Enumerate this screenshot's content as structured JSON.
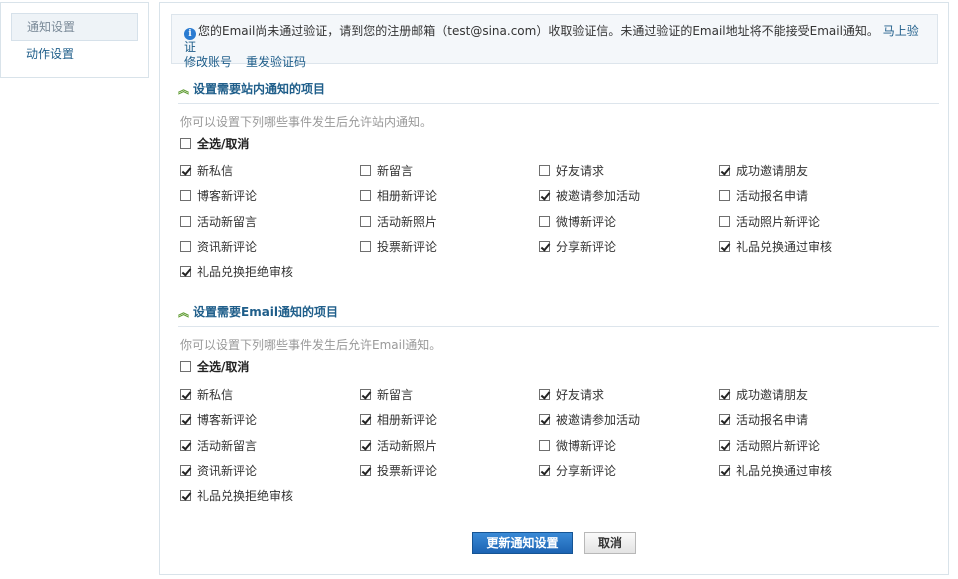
{
  "sidebar": {
    "items": [
      {
        "label": "通知设置",
        "active": true
      },
      {
        "label": "动作设置",
        "active": false
      }
    ]
  },
  "notice": {
    "icon": "info-icon",
    "text": "您的Email尚未通过验证，请到您的注册邮箱（test@sina.com）收取验证信。未通过验证的Email地址将不能接受Email通知。",
    "verify_link": "马上验证",
    "change_account_link": "修改账号",
    "resend_link": "重发验证码"
  },
  "site_section": {
    "title": "设置需要站内通知的项目",
    "hint": "你可以设置下列哪些事件发生后允许站内通知。",
    "select_all": {
      "label": "全选/取消",
      "checked": false
    },
    "options": [
      {
        "label": "新私信",
        "checked": true
      },
      {
        "label": "新留言",
        "checked": false
      },
      {
        "label": "好友请求",
        "checked": false
      },
      {
        "label": "成功邀请朋友",
        "checked": true
      },
      {
        "label": "博客新评论",
        "checked": false
      },
      {
        "label": "相册新评论",
        "checked": false
      },
      {
        "label": "被邀请参加活动",
        "checked": true
      },
      {
        "label": "活动报名申请",
        "checked": false
      },
      {
        "label": "活动新留言",
        "checked": false
      },
      {
        "label": "活动新照片",
        "checked": false
      },
      {
        "label": "微博新评论",
        "checked": false
      },
      {
        "label": "活动照片新评论",
        "checked": false
      },
      {
        "label": "资讯新评论",
        "checked": false
      },
      {
        "label": "投票新评论",
        "checked": false
      },
      {
        "label": "分享新评论",
        "checked": true
      },
      {
        "label": "礼品兑换通过审核",
        "checked": true
      },
      {
        "label": "礼品兑换拒绝审核",
        "checked": true
      }
    ]
  },
  "email_section": {
    "title": "设置需要Email通知的项目",
    "hint": "你可以设置下列哪些事件发生后允许Email通知。",
    "select_all": {
      "label": "全选/取消",
      "checked": false
    },
    "options": [
      {
        "label": "新私信",
        "checked": true
      },
      {
        "label": "新留言",
        "checked": true
      },
      {
        "label": "好友请求",
        "checked": true
      },
      {
        "label": "成功邀请朋友",
        "checked": true
      },
      {
        "label": "博客新评论",
        "checked": true
      },
      {
        "label": "相册新评论",
        "checked": true
      },
      {
        "label": "被邀请参加活动",
        "checked": true
      },
      {
        "label": "活动报名申请",
        "checked": true
      },
      {
        "label": "活动新留言",
        "checked": true
      },
      {
        "label": "活动新照片",
        "checked": true
      },
      {
        "label": "微博新评论",
        "checked": false
      },
      {
        "label": "活动照片新评论",
        "checked": true
      },
      {
        "label": "资讯新评论",
        "checked": true
      },
      {
        "label": "投票新评论",
        "checked": true
      },
      {
        "label": "分享新评论",
        "checked": true
      },
      {
        "label": "礼品兑换通过审核",
        "checked": true
      },
      {
        "label": "礼品兑换拒绝审核",
        "checked": true
      }
    ]
  },
  "actions": {
    "update_label": "更新通知设置",
    "cancel_label": "取消"
  },
  "colors": {
    "link": "#1f5e8a",
    "primary_button": "#1c63b3",
    "section_chevron": "#5c9a2e",
    "hint_text": "#999999"
  }
}
